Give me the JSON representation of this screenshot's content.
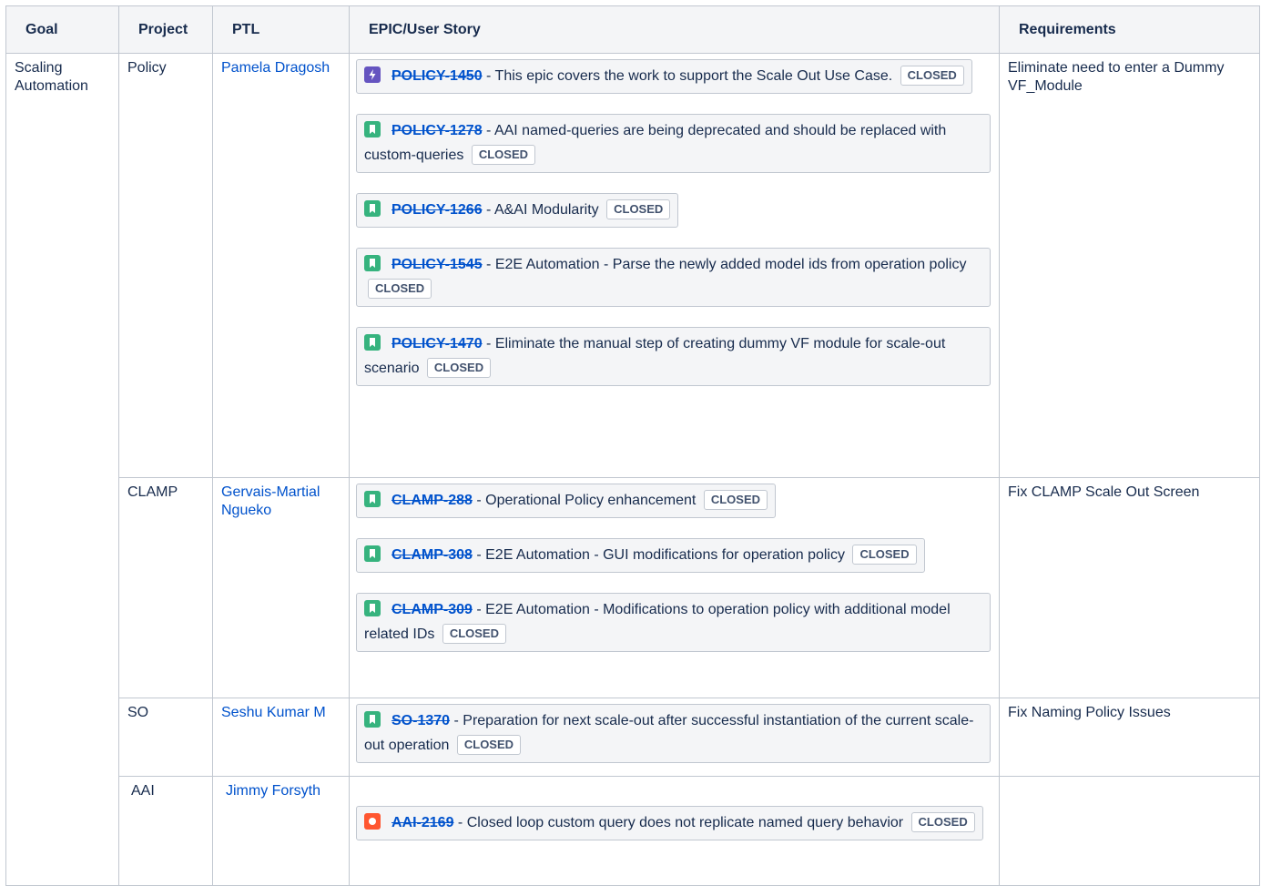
{
  "headers": {
    "goal": "Goal",
    "project": "Project",
    "ptl": "PTL",
    "epic": "EPIC/User Story",
    "requirements": "Requirements"
  },
  "row_policy": {
    "goal": "Scaling Automation",
    "project": "Policy",
    "ptl": "Pamela Dragosh",
    "requirements": "Eliminate need to enter a Dummy VF_Module",
    "issues": [
      {
        "icon": "epic-icon",
        "key": "POLICY-1450",
        "summary": " - This epic covers the work to support the Scale Out Use Case. ",
        "status": "CLOSED"
      },
      {
        "icon": "story-icon",
        "key": "POLICY-1278",
        "summary": " - AAI named-queries are being deprecated and should be replaced with custom-queries ",
        "status": "CLOSED"
      },
      {
        "icon": "story-icon",
        "key": "POLICY-1266",
        "summary": " - A&AI Modularity ",
        "status": "CLOSED"
      },
      {
        "icon": "story-icon",
        "key": "POLICY-1545",
        "summary": " - E2E Automation - Parse the newly added model ids from operation policy ",
        "status": "CLOSED"
      },
      {
        "icon": "story-icon",
        "key": "POLICY-1470",
        "summary": " - Eliminate the manual step of creating dummy VF module for scale-out scenario ",
        "status": "CLOSED"
      }
    ]
  },
  "row_clamp": {
    "project": "CLAMP",
    "ptl": "Gervais-Martial Ngueko",
    "requirements": "Fix CLAMP Scale Out Screen",
    "issues": [
      {
        "icon": "story-icon",
        "key": "CLAMP-288",
        "summary": " - Operational Policy enhancement ",
        "status": "CLOSED"
      },
      {
        "icon": "story-icon",
        "key": "CLAMP-308",
        "summary": " - E2E Automation - GUI modifications for operation policy ",
        "status": "CLOSED"
      },
      {
        "icon": "story-icon",
        "key": "CLAMP-309",
        "summary": " - E2E Automation - Modifications to operation policy with additional model related IDs ",
        "status": "CLOSED"
      }
    ]
  },
  "row_so": {
    "project": "SO",
    "ptl": "Seshu Kumar M",
    "requirements": "Fix Naming Policy Issues",
    "issues": [
      {
        "icon": "story-icon",
        "key": "SO-1370",
        "summary": " - Preparation for next scale-out after successful instantiation of the current scale-out operation ",
        "status": "CLOSED"
      }
    ]
  },
  "row_aai": {
    "project": "AAI",
    "ptl": "Jimmy Forsyth",
    "requirements": "",
    "issues": [
      {
        "icon": "bug-icon",
        "key": "AAI-2169",
        "summary": " - Closed loop custom query does not replicate named query behavior ",
        "status": "CLOSED"
      }
    ]
  },
  "colors": {
    "link": "#0052cc",
    "epic_icon": "#6554c0",
    "story_icon": "#36b37e",
    "bug_icon": "#ff5630",
    "header_bg": "#f4f5f7",
    "border": "#c1c7d0"
  }
}
